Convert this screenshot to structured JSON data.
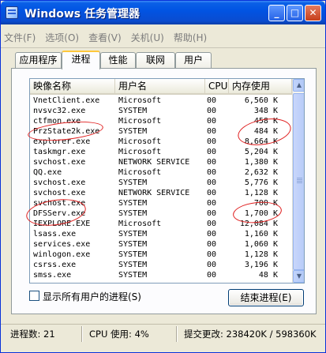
{
  "window": {
    "title": "Windows 任务管理器",
    "controls": {
      "minimize": "_",
      "maximize": "□",
      "close": "✕"
    }
  },
  "menu": [
    "文件(F)",
    "选项(O)",
    "查看(V)",
    "关机(U)",
    "帮助(H)"
  ],
  "tabs": [
    "应用程序",
    "进程",
    "性能",
    "联网",
    "用户"
  ],
  "active_tab": "进程",
  "table": {
    "headers": {
      "name": "映像名称",
      "user": "用户名",
      "cpu": "CPU",
      "mem": "内存使用"
    },
    "rows": [
      {
        "name": "VnetClient.exe",
        "user": "Microsoft",
        "cpu": "00",
        "mem": "6,560 K"
      },
      {
        "name": "nvsvc32.exe",
        "user": "SYSTEM",
        "cpu": "00",
        "mem": "348 K"
      },
      {
        "name": "ctfmon.exe",
        "user": "Microsoft",
        "cpu": "00",
        "mem": "458 K"
      },
      {
        "name": "PrzState2k.exe",
        "user": "SYSTEM",
        "cpu": "00",
        "mem": "484 K"
      },
      {
        "name": "explorer.exe",
        "user": "Microsoft",
        "cpu": "00",
        "mem": "8,664 K"
      },
      {
        "name": "taskmgr.exe",
        "user": "Microsoft",
        "cpu": "00",
        "mem": "5,204 K"
      },
      {
        "name": "svchost.exe",
        "user": "NETWORK SERVICE",
        "cpu": "00",
        "mem": "1,380 K"
      },
      {
        "name": "QQ.exe",
        "user": "Microsoft",
        "cpu": "00",
        "mem": "2,632 K"
      },
      {
        "name": "svchost.exe",
        "user": "SYSTEM",
        "cpu": "00",
        "mem": "5,776 K"
      },
      {
        "name": "svchost.exe",
        "user": "NETWORK SERVICE",
        "cpu": "00",
        "mem": "1,128 K"
      },
      {
        "name": "svchost.exe",
        "user": "SYSTEM",
        "cpu": "00",
        "mem": "700 K"
      },
      {
        "name": "DFSServ.exe",
        "user": "SYSTEM",
        "cpu": "00",
        "mem": "1,700 K"
      },
      {
        "name": "IEXPLORE.EXE",
        "user": "Microsoft",
        "cpu": "00",
        "mem": "12,084 K"
      },
      {
        "name": "lsass.exe",
        "user": "SYSTEM",
        "cpu": "00",
        "mem": "1,160 K"
      },
      {
        "name": "services.exe",
        "user": "SYSTEM",
        "cpu": "00",
        "mem": "1,060 K"
      },
      {
        "name": "winlogon.exe",
        "user": "SYSTEM",
        "cpu": "00",
        "mem": "1,128 K"
      },
      {
        "name": "csrss.exe",
        "user": "SYSTEM",
        "cpu": "00",
        "mem": "3,196 K"
      },
      {
        "name": "smss.exe",
        "user": "SYSTEM",
        "cpu": "00",
        "mem": "48 K"
      }
    ]
  },
  "show_all_users_label": "显示所有用户的进程(S)",
  "end_process_label": "结束进程(E)",
  "status": {
    "processes": "进程数: 21",
    "cpu": "CPU 使用: 4%",
    "commit": "提交更改: 238420K / 598360K"
  },
  "colors": {
    "title_bar": "#0154e3",
    "annotation": "#e02020",
    "tab_highlight": "#ffc83c"
  }
}
